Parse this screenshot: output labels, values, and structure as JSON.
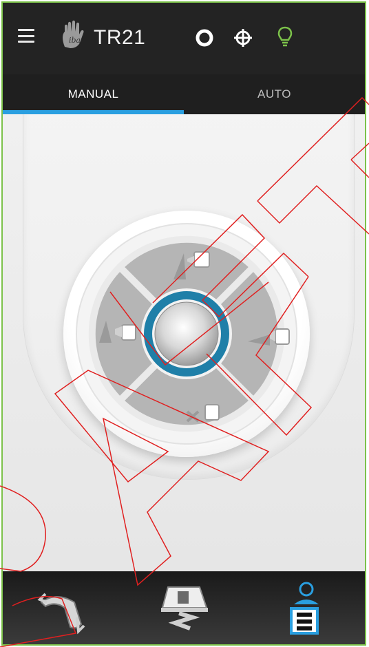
{
  "header": {
    "title": "TR21",
    "logo_text": "iba"
  },
  "tabs": [
    {
      "label": "MANUAL",
      "active": true
    },
    {
      "label": "AUTO",
      "active": false
    }
  ],
  "colors": {
    "accent": "#2a9fe0",
    "bulb": "#7cc24a",
    "ring": "#1f7fa8",
    "annotation": "#e02020"
  },
  "icons": {
    "menu": "hamburger-icon",
    "ring": "ring-icon",
    "crosshair": "crosshair-icon",
    "bulb": "bulb-icon",
    "gantry": "gantry-rotation-icon",
    "couch": "couch-icon",
    "patient": "patient-position-icon"
  }
}
